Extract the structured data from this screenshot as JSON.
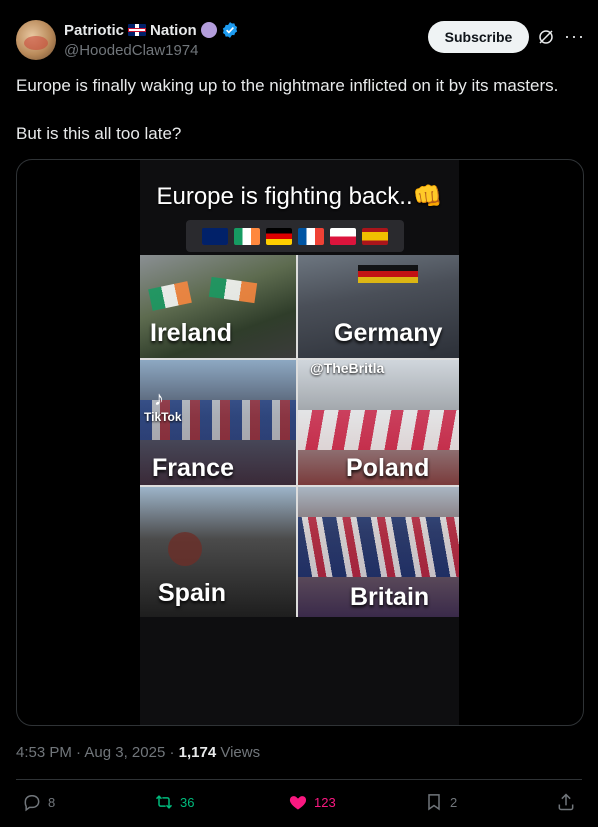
{
  "author": {
    "display_name": "Patriotic",
    "display_name_suffix": "Nation",
    "handle": "@HoodedClaw1974"
  },
  "header": {
    "subscribe_label": "Subscribe"
  },
  "tweet": {
    "paragraphs": [
      "Europe is finally waking up to the nightmare inflicted on it by its masters.",
      "But is this all too late?"
    ]
  },
  "media": {
    "title": "Europe is fighting back..👊",
    "tiktok_label": "TikTok",
    "watermark": "@TheBritla",
    "panels": [
      {
        "label": "Ireland"
      },
      {
        "label": "Germany"
      },
      {
        "label": "France"
      },
      {
        "label": "Poland"
      },
      {
        "label": "Spain"
      },
      {
        "label": "Britain"
      }
    ]
  },
  "meta": {
    "time": "4:53 PM",
    "date": "Aug 3, 2025",
    "views_count": "1,174",
    "views_label": "Views"
  },
  "actions": {
    "replies": "8",
    "reposts": "36",
    "likes": "123",
    "bookmarks": "2"
  },
  "colors": {
    "repost_active": "#00ba7c",
    "like_active": "#f91880",
    "verified": "#1d9bf0"
  }
}
